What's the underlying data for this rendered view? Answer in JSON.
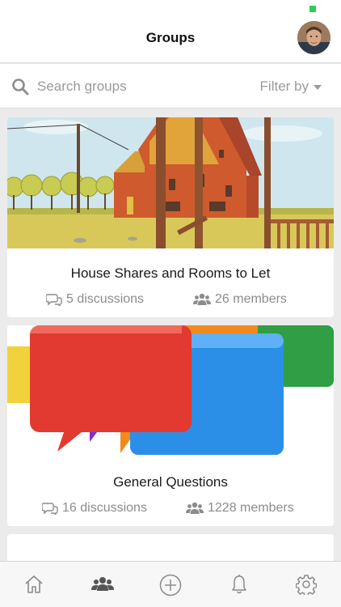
{
  "header": {
    "title": "Groups"
  },
  "search": {
    "placeholder": "Search groups",
    "filter_label": "Filter by"
  },
  "groups": [
    {
      "name": "House Shares and Rooms to Let",
      "discussions": "5 discussions",
      "members": "26 members"
    },
    {
      "name": "General Questions",
      "discussions": "16 discussions",
      "members": "1228 members"
    }
  ],
  "tabs": [
    {
      "icon": "home-icon",
      "active": false
    },
    {
      "icon": "groups-icon",
      "active": true
    },
    {
      "icon": "add-icon",
      "active": false
    },
    {
      "icon": "bell-icon",
      "active": false
    },
    {
      "icon": "gear-icon",
      "active": false
    }
  ],
  "colors": {
    "status_indicator": "#2ecc52",
    "muted_text": "#8c8c8c",
    "background": "#ebebeb"
  }
}
